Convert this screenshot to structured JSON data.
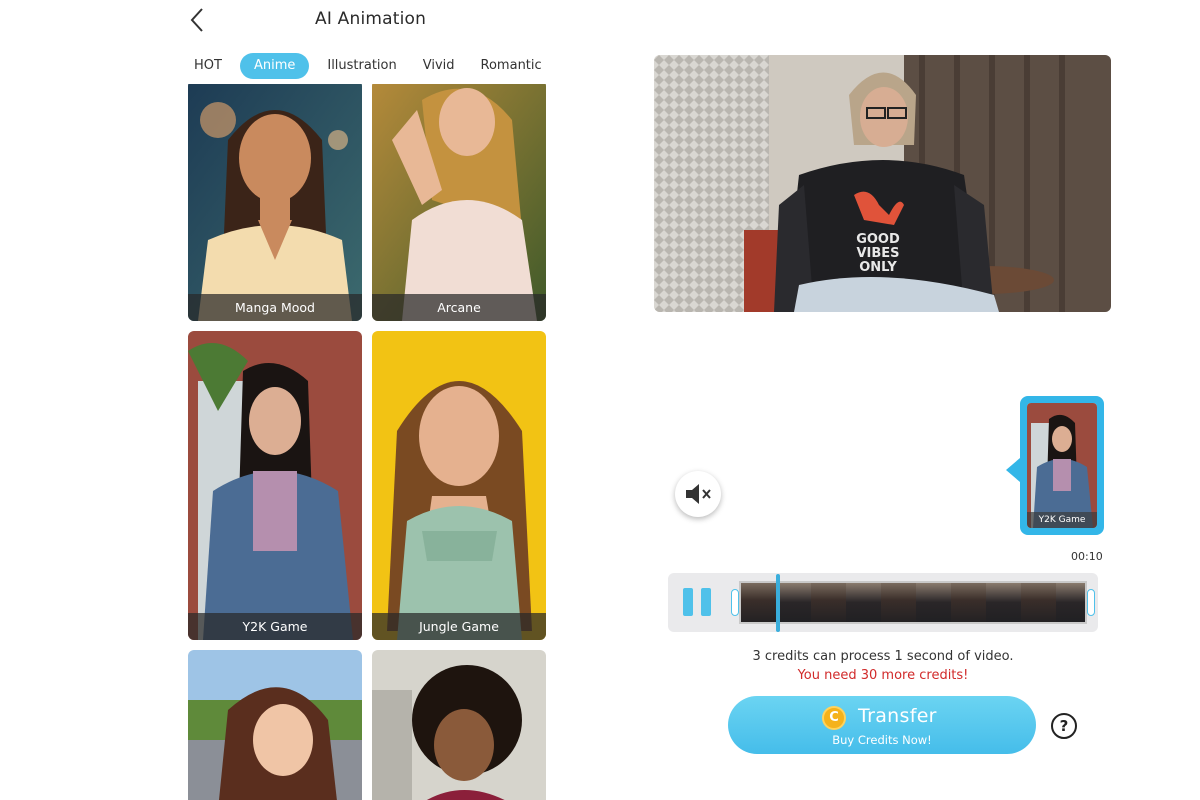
{
  "header": {
    "title": "AI Animation"
  },
  "tabs": [
    {
      "label": "HOT"
    },
    {
      "label": "Anime",
      "active": true
    },
    {
      "label": "Illustration"
    },
    {
      "label": "Vivid"
    },
    {
      "label": "Romantic"
    }
  ],
  "gallery": {
    "cards": [
      {
        "label": "Manga Mood"
      },
      {
        "label": "Arcane"
      },
      {
        "label": "Y2K Game"
      },
      {
        "label": "Jungle Game"
      },
      {
        "label": ""
      },
      {
        "label": ""
      }
    ]
  },
  "preview": {
    "shirt_text": [
      "GOOD",
      "VIBES",
      "ONLY"
    ]
  },
  "selected_style": {
    "label": "Y2K Game"
  },
  "timeline": {
    "duration": "00:10"
  },
  "credits": {
    "info": "3 credits can process 1 second of video.",
    "warning": "You need 30 more credits!"
  },
  "transfer": {
    "coin": "C",
    "label": "Transfer",
    "sublabel": "Buy Credits Now!"
  },
  "help": {
    "glyph": "?"
  },
  "colors": {
    "accent": "#4fc1ea",
    "warning": "#d12a2a",
    "coin": "#f5b21b"
  }
}
